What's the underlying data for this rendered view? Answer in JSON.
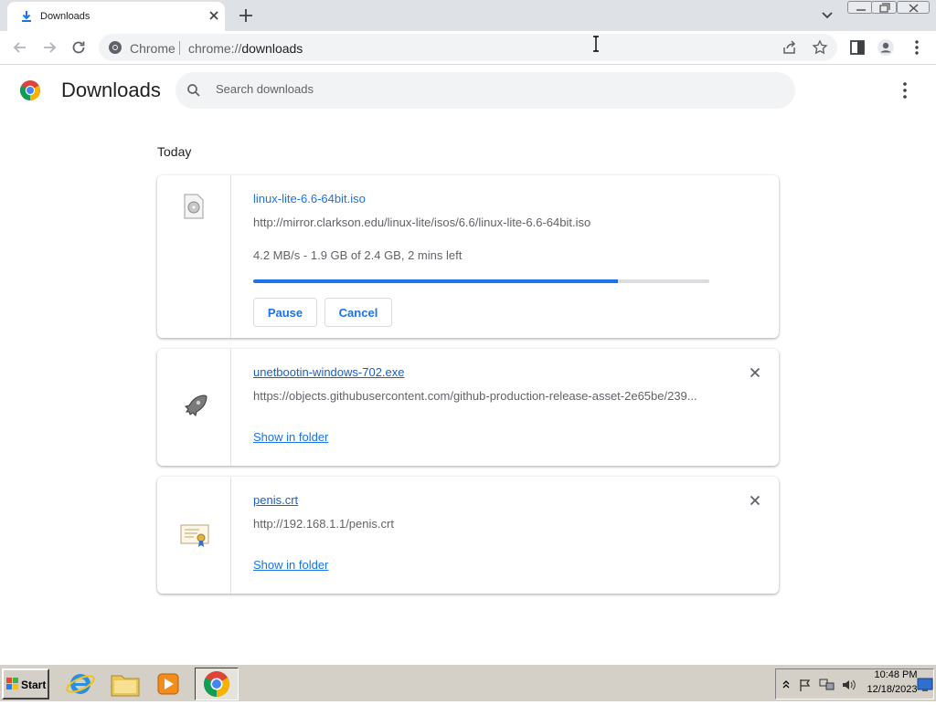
{
  "browser": {
    "tab_title": "Downloads",
    "omnibox_chip": "Chrome",
    "url_scheme": "chrome://",
    "url_path": "downloads"
  },
  "page": {
    "title": "Downloads",
    "search_placeholder": "Search downloads",
    "section_label": "Today"
  },
  "downloads": [
    {
      "file_name": "linux-lite-6.6-64bit.iso",
      "url": "http://mirror.clarkson.edu/linux-lite/isos/6.6/linux-lite-6.6-64bit.iso",
      "status": "4.2 MB/s - 1.9 GB of 2.4 GB, 2 mins left",
      "progress": 0.8,
      "pause_label": "Pause",
      "cancel_label": "Cancel",
      "icon": "disc-file-icon"
    },
    {
      "file_name": "unetbootin-windows-702.exe",
      "url": "https://objects.githubusercontent.com/github-production-release-asset-2e65be/239...",
      "action_label": "Show in folder",
      "icon": "rocket-app-icon"
    },
    {
      "file_name": "penis.crt",
      "url": "http://192.168.1.1/penis.crt",
      "action_label": "Show in folder",
      "icon": "certificate-icon"
    }
  ],
  "taskbar": {
    "start_label": "Start",
    "time": "10:48 PM",
    "date": "12/18/2023"
  },
  "colors": {
    "accent": "#1a73e8",
    "tabstrip": "#dee1e6",
    "taskbar": "#d4d0c8"
  }
}
